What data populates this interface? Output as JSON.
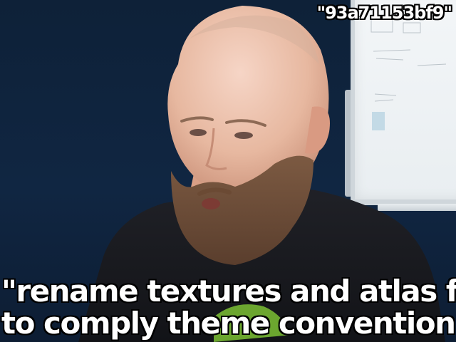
{
  "image": {
    "id_label": "\"93a71153bf9\"",
    "caption": {
      "line1": "\"rename textures and atlas files",
      "line2": "to comply theme convention\""
    }
  },
  "colors": {
    "background": "#0f2035",
    "skin": "#e7b8a0",
    "beard": "#6b4a34",
    "shirt": "#1b1b1f",
    "whiteboard": "#eef2f4",
    "text": "#ffffff",
    "text_outline": "#000000"
  }
}
